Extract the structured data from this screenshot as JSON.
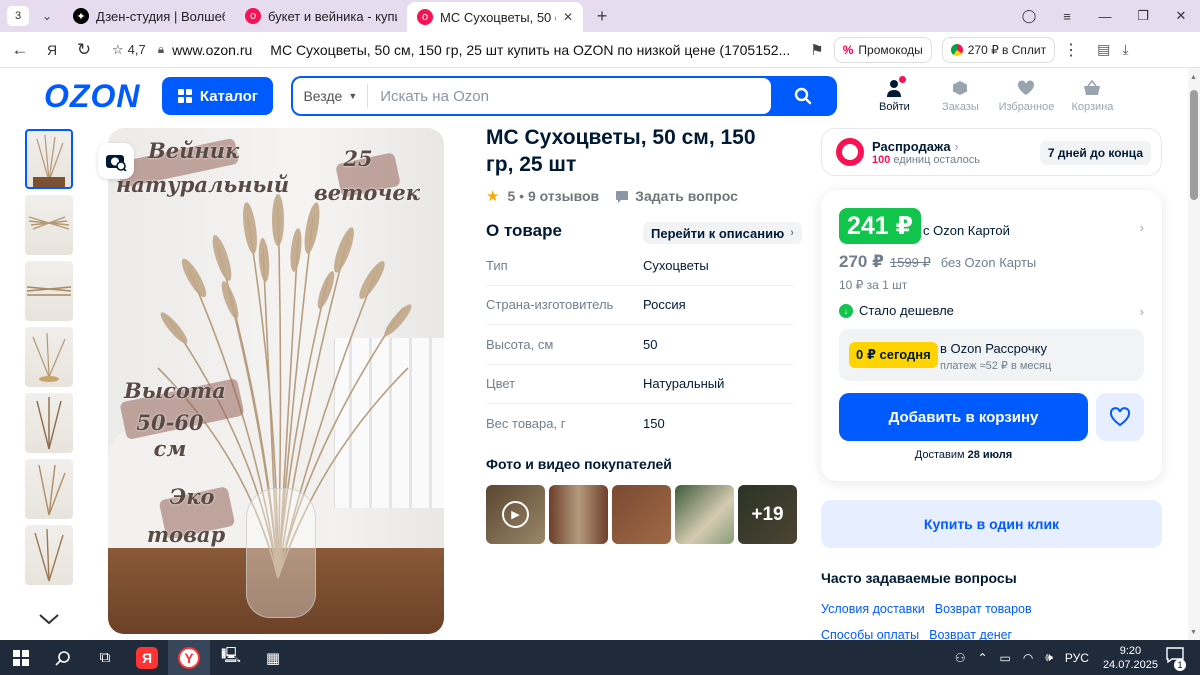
{
  "browser": {
    "tab_count": "3",
    "tabs": [
      {
        "title": "Дзен-студия | Волшебств"
      },
      {
        "title": "букет и вейника - купить"
      },
      {
        "title": "МС Сухоцветы, 50 см, 1"
      }
    ],
    "rating": "4,7",
    "domain": "www.ozon.ru",
    "page_title": "МС Сухоцветы, 50 см, 150 гр, 25 шт купить на OZON по низкой цене (1705152...",
    "promo_label": "Промокоды",
    "split_label": "270 ₽ в Сплит",
    "download_badge": "1"
  },
  "header": {
    "logo": "OZON",
    "catalog_label": "Каталог",
    "search_scope": "Везде",
    "search_placeholder": "Искать на Ozon",
    "actions": [
      {
        "label": "Войти"
      },
      {
        "label": "Заказы"
      },
      {
        "label": "Избранное"
      },
      {
        "label": "Корзина"
      }
    ]
  },
  "gallery": {
    "overlay": {
      "line1a": "Вейник",
      "line1b": "натуральный",
      "line2a": "25",
      "line2b": "веточек",
      "line3a": "Высота",
      "line3b": "50-60 см",
      "line4a": "Эко",
      "line4b": "товар"
    }
  },
  "product": {
    "title": "МС Сухоцветы, 50 см, 150 гр, 25 шт",
    "rating": "5",
    "reviews": "9 отзывов",
    "ask_question": "Задать вопрос",
    "about_title": "О товаре",
    "goto_description": "Перейти к описанию",
    "attributes": [
      {
        "key": "Тип",
        "value": "Сухоцветы"
      },
      {
        "key": "Страна-изготовитель",
        "value": "Россия"
      },
      {
        "key": "Высота, см",
        "value": "50"
      },
      {
        "key": "Цвет",
        "value": "Натуральный"
      },
      {
        "key": "Вес товара, г",
        "value": "150"
      }
    ],
    "photos_title": "Фото и видео покупателей",
    "photos_more": "+19"
  },
  "sale": {
    "title": "Распродажа",
    "remaining_count": "100",
    "remaining_text": "единиц осталось",
    "days_left": "7 дней до конца"
  },
  "price": {
    "card_price": "241 ₽",
    "card_label": "с Ozon Картой",
    "regular_price": "270 ₽",
    "old_price": "1599 ₽",
    "regular_label": "без Ozon Карты",
    "per_unit": "10 ₽ за 1 шт",
    "cheaper": "Стало дешевле",
    "installment_badge": "0 ₽ сегодня",
    "installment_title": "в Ozon Рассрочку",
    "installment_sub": "платеж ≈52 ₽ в месяц",
    "add_to_cart": "Добавить в корзину",
    "delivery_label": "Доставим",
    "delivery_date": "28 июля"
  },
  "one_click": "Купить в один клик",
  "faq": {
    "title": "Часто задаваемые вопросы",
    "links": [
      "Условия доставки",
      "Возврат товаров",
      "Способы оплаты",
      "Возврат денег"
    ]
  },
  "taskbar": {
    "lang": "РУС",
    "time": "9:20",
    "date": "24.07.2025",
    "notifications": "1"
  },
  "colors": {
    "ozon_blue": "#005bff",
    "ozon_green": "#10c44c",
    "ozon_pink": "#f91155",
    "install_yellow": "#ffd400"
  }
}
